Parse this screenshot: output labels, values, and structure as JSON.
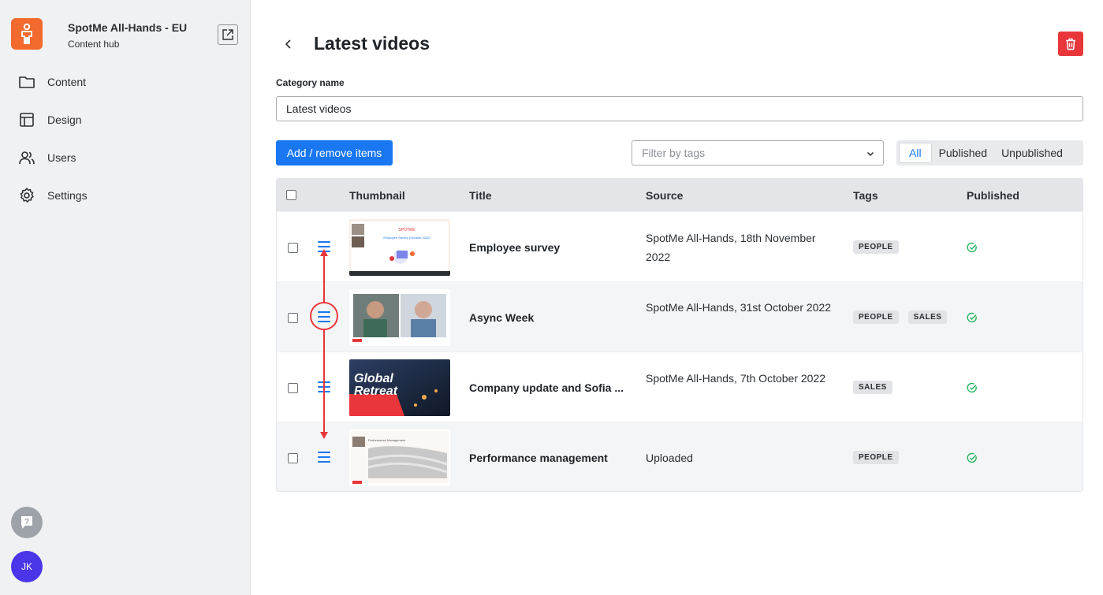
{
  "sidebar": {
    "app_name": "SpotMe All-Hands - EU",
    "app_subtitle": "Content hub",
    "avatar_initials": "JK",
    "items": [
      {
        "label": "Content",
        "icon": "folder-icon"
      },
      {
        "label": "Design",
        "icon": "layout-icon"
      },
      {
        "label": "Users",
        "icon": "users-icon"
      },
      {
        "label": "Settings",
        "icon": "gear-icon"
      }
    ]
  },
  "header": {
    "title": "Latest videos"
  },
  "form": {
    "category_label": "Category name",
    "category_value": "Latest videos"
  },
  "toolbar": {
    "add_label": "Add / remove items",
    "filter_placeholder": "Filter by tags",
    "segments": [
      "All",
      "Published",
      "Unpublished"
    ],
    "active_segment": "All"
  },
  "table": {
    "columns": [
      "Thumbnail",
      "Title",
      "Source",
      "Tags",
      "Published"
    ],
    "rows": [
      {
        "title": "Employee survey",
        "source": "SpotMe All-Hands, 18th November 2022",
        "tags": [
          "PEOPLE"
        ],
        "published": true
      },
      {
        "title": "Async Week",
        "source": "SpotMe All-Hands, 31st October 2022",
        "tags": [
          "PEOPLE",
          "SALES"
        ],
        "published": true
      },
      {
        "title": "Company update and Sofia ...",
        "source": "SpotMe All-Hands, 7th October 2022",
        "tags": [
          "SALES"
        ],
        "published": true
      },
      {
        "title": "Performance management",
        "source": "Uploaded",
        "tags": [
          "PEOPLE"
        ],
        "published": true
      }
    ]
  },
  "thumbnails": {
    "row1_brand": "SPOTME",
    "row1_caption": "Employee Survey (October 2022)",
    "row3_line1": "Global",
    "row3_line2": "Retreat",
    "row4_caption": "Performance Management"
  },
  "colors": {
    "accent": "#1977f2",
    "brand_orange": "#f26a2e",
    "danger": "#e8363b",
    "success": "#22b35e",
    "annotation": "#e8363b"
  }
}
